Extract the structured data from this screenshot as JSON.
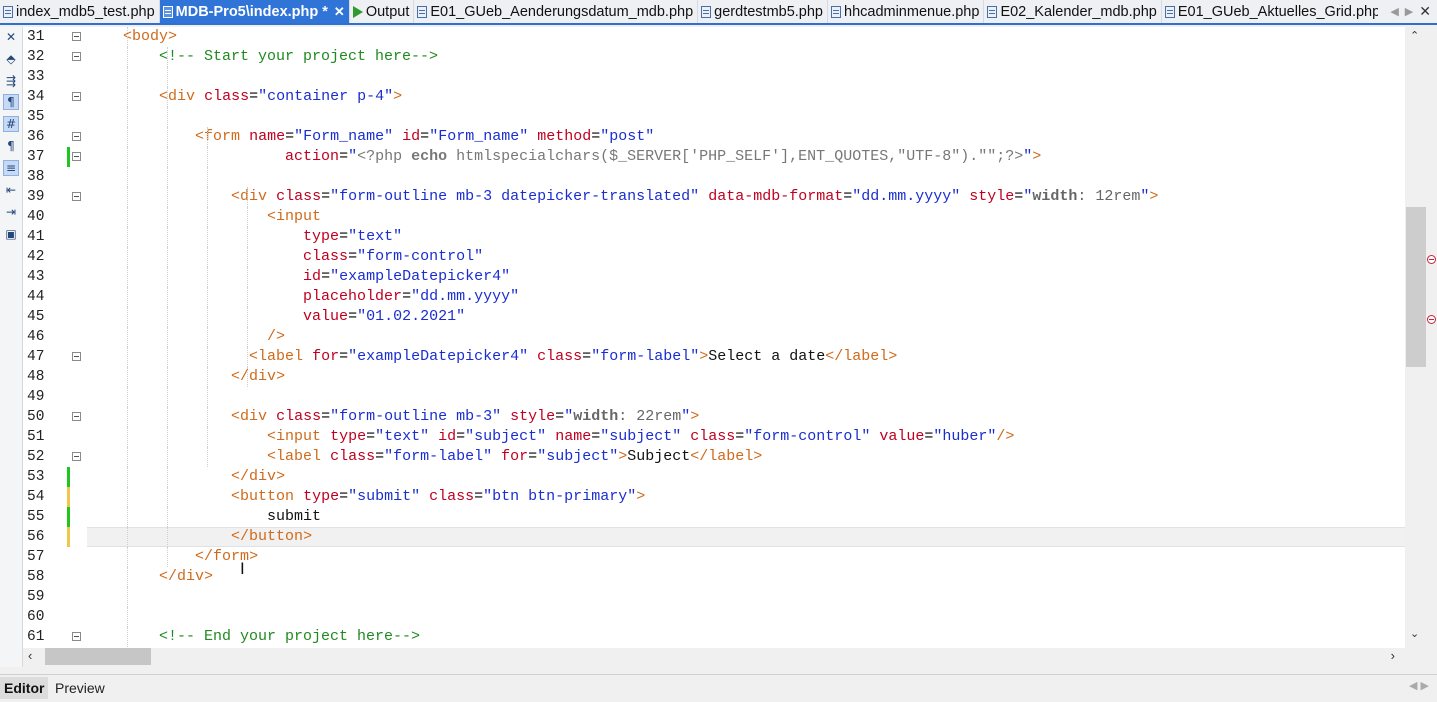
{
  "tabs": [
    {
      "label": "index_mdb5_test.php",
      "icon": "php-file-icon",
      "active": false
    },
    {
      "label": "MDB-Pro5\\index.php *",
      "icon": "php-file-icon",
      "active": true
    },
    {
      "label": "Output",
      "icon": "play-icon",
      "active": false
    },
    {
      "label": "E01_GUeb_Aenderungsdatum_mdb.php",
      "icon": "php-file-icon",
      "active": false
    },
    {
      "label": "gerdtestmb5.php",
      "icon": "php-file-icon",
      "active": false
    },
    {
      "label": "hhcadminmenue.php",
      "icon": "php-file-icon",
      "active": false
    },
    {
      "label": "E02_Kalender_mdb.php",
      "icon": "php-file-icon",
      "active": false
    },
    {
      "label": "E01_GUeb_Aktuelles_Grid.php",
      "icon": "php-file-icon",
      "active": false
    }
  ],
  "tab_close_glyph": "✕",
  "left_toolbar": [
    "close-icon",
    "toggle-icon",
    "wrap-icon",
    "indent-guide-icon",
    "hash-icon",
    "pilcrow-icon",
    "format-icon",
    "outdent-icon",
    "indent-icon",
    "preview-icon"
  ],
  "code": {
    "lines": [
      {
        "n": "31",
        "fold": true,
        "chg": "",
        "html": "    <span class=\"t-brk\">&lt;</span><span class=\"t-tag\">body</span><span class=\"t-brk\">&gt;</span>"
      },
      {
        "n": "32",
        "fold": true,
        "chg": "",
        "html": "        <span class=\"t-cm\">&lt;!-- Start your project here--&gt;</span>"
      },
      {
        "n": "33",
        "fold": false,
        "chg": "",
        "html": ""
      },
      {
        "n": "34",
        "fold": true,
        "chg": "",
        "html": "        <span class=\"t-brk\">&lt;</span><span class=\"t-tag\">div</span> <span class=\"t-attr\">class</span>=<span class=\"t-val\">\"container p-4\"</span><span class=\"t-brk\">&gt;</span>"
      },
      {
        "n": "35",
        "fold": false,
        "chg": "",
        "html": ""
      },
      {
        "n": "36",
        "fold": true,
        "chg": "",
        "html": "            <span class=\"t-brk\">&lt;</span><span class=\"t-tag\">form</span> <span class=\"t-attr\">name</span>=<span class=\"t-val\">\"Form_name\"</span> <span class=\"t-attr\">id</span>=<span class=\"t-val\">\"Form_name\"</span> <span class=\"t-attr\">method</span>=<span class=\"t-val\">\"post\"</span>"
      },
      {
        "n": "37",
        "fold": true,
        "chg": "green",
        "html": "                      <span class=\"t-attr\">action</span>=<span class=\"t-val\">\"</span><span class=\"t-php\">&lt;?php </span><span class=\"t-phpk\">echo</span><span class=\"t-php\"> htmlspecialchars($_SERVER['PHP_SELF'],ENT_QUOTES,\"UTF-8\").\"\";?&gt;</span><span class=\"t-val\">\"</span><span class=\"t-brk\">&gt;</span>"
      },
      {
        "n": "38",
        "fold": false,
        "chg": "",
        "html": ""
      },
      {
        "n": "39",
        "fold": true,
        "chg": "",
        "html": "                <span class=\"t-brk\">&lt;</span><span class=\"t-tag\">div</span> <span class=\"t-attr\">class</span>=<span class=\"t-val\">\"form-outline mb-3 datepicker-translated\"</span> <span class=\"t-attr\">data-mdb-format</span>=<span class=\"t-val\">\"dd.mm.yyyy\"</span> <span class=\"t-attr\">style</span>=<span class=\"t-val\">\"</span><span class=\"t-cssk\">width</span><span class=\"t-cssv\">: 12rem</span><span class=\"t-val\">\"</span><span class=\"t-brk\">&gt;</span>"
      },
      {
        "n": "40",
        "fold": false,
        "chg": "",
        "html": "                    <span class=\"t-brk\">&lt;</span><span class=\"t-tag\">input</span>"
      },
      {
        "n": "41",
        "fold": false,
        "chg": "",
        "html": "                        <span class=\"t-attr\">type</span>=<span class=\"t-val\">\"text\"</span>"
      },
      {
        "n": "42",
        "fold": false,
        "chg": "",
        "html": "                        <span class=\"t-attr\">class</span>=<span class=\"t-val\">\"form-control\"</span>"
      },
      {
        "n": "43",
        "fold": false,
        "chg": "",
        "html": "                        <span class=\"t-attr\">id</span>=<span class=\"t-val\">\"exampleDatepicker4\"</span>"
      },
      {
        "n": "44",
        "fold": false,
        "chg": "",
        "html": "                        <span class=\"t-attr\">placeholder</span>=<span class=\"t-val\">\"dd.mm.yyyy\"</span>"
      },
      {
        "n": "45",
        "fold": false,
        "chg": "",
        "html": "                        <span class=\"t-attr\">value</span>=<span class=\"t-val\">\"01.02.2021\"</span>"
      },
      {
        "n": "46",
        "fold": false,
        "chg": "",
        "html": "                    <span class=\"t-brk\">/&gt;</span>"
      },
      {
        "n": "47",
        "fold": true,
        "chg": "",
        "html": "                  <span class=\"t-brk\">&lt;</span><span class=\"t-tag\">label</span> <span class=\"t-attr\">for</span>=<span class=\"t-val\">\"exampleDatepicker4\"</span> <span class=\"t-attr\">class</span>=<span class=\"t-val\">\"form-label\"</span><span class=\"t-brk\">&gt;</span><span class=\"t-txt\">Select a date</span><span class=\"t-brk\">&lt;/</span><span class=\"t-tag\">label</span><span class=\"t-brk\">&gt;</span>"
      },
      {
        "n": "48",
        "fold": false,
        "chg": "",
        "html": "                <span class=\"t-brk\">&lt;/</span><span class=\"t-tag\">div</span><span class=\"t-brk\">&gt;</span>"
      },
      {
        "n": "49",
        "fold": false,
        "chg": "",
        "html": ""
      },
      {
        "n": "50",
        "fold": true,
        "chg": "",
        "html": "                <span class=\"t-brk\">&lt;</span><span class=\"t-tag\">div</span> <span class=\"t-attr\">class</span>=<span class=\"t-val\">\"form-outline mb-3\"</span> <span class=\"t-attr\">style</span>=<span class=\"t-val\">\"</span><span class=\"t-cssk\">width</span><span class=\"t-cssv\">: 22rem</span><span class=\"t-val\">\"</span><span class=\"t-brk\">&gt;</span>"
      },
      {
        "n": "51",
        "fold": false,
        "chg": "",
        "html": "                    <span class=\"t-brk\">&lt;</span><span class=\"t-tag\">input</span> <span class=\"t-attr\">type</span>=<span class=\"t-val\">\"text\"</span> <span class=\"t-attr\">id</span>=<span class=\"t-val\">\"subject\"</span> <span class=\"t-attr\">name</span>=<span class=\"t-val\">\"subject\"</span> <span class=\"t-attr\">class</span>=<span class=\"t-val\">\"form-control\"</span> <span class=\"t-attr\">value</span>=<span class=\"t-val\">\"huber\"</span><span class=\"t-brk\">/&gt;</span>"
      },
      {
        "n": "52",
        "fold": true,
        "chg": "",
        "html": "                    <span class=\"t-brk\">&lt;</span><span class=\"t-tag\">label</span> <span class=\"t-attr\">class</span>=<span class=\"t-val\">\"form-label\"</span> <span class=\"t-attr\">for</span>=<span class=\"t-val\">\"subject\"</span><span class=\"t-brk\">&gt;</span><span class=\"t-txt\">Subject</span><span class=\"t-brk\">&lt;/</span><span class=\"t-tag\">label</span><span class=\"t-brk\">&gt;</span>"
      },
      {
        "n": "53",
        "fold": false,
        "chg": "green",
        "html": "                <span class=\"t-brk\">&lt;/</span><span class=\"t-tag\">div</span><span class=\"t-brk\">&gt;</span>"
      },
      {
        "n": "54",
        "fold": false,
        "chg": "yellow",
        "html": "                <span class=\"t-brk\">&lt;</span><span class=\"t-tag\">button</span> <span class=\"t-attr\">type</span>=<span class=\"t-val\">\"submit\"</span> <span class=\"t-attr\">class</span>=<span class=\"t-val\">\"btn btn-primary\"</span><span class=\"t-brk\">&gt;</span>"
      },
      {
        "n": "55",
        "fold": false,
        "chg": "green",
        "html": "                   <span class=\"t-txt\"> submit</span>"
      },
      {
        "n": "56",
        "fold": false,
        "chg": "yellow",
        "cur": true,
        "html": "                <span class=\"t-brk\">&lt;/</span><span class=\"t-tag\">button</span><span class=\"t-brk\">&gt;</span>"
      },
      {
        "n": "57",
        "fold": false,
        "chg": "",
        "html": "            <span class=\"t-brk\">&lt;/</span><span class=\"t-tag\">form</span><span class=\"t-brk\">&gt;</span>"
      },
      {
        "n": "58",
        "fold": false,
        "chg": "",
        "html": "        <span class=\"t-brk\">&lt;/</span><span class=\"t-tag\">div</span><span class=\"t-brk\">&gt;</span>"
      },
      {
        "n": "59",
        "fold": false,
        "chg": "",
        "html": ""
      },
      {
        "n": "60",
        "fold": false,
        "chg": "",
        "html": ""
      },
      {
        "n": "61",
        "fold": true,
        "chg": "",
        "html": "        <span class=\"t-cm\">&lt;!-- End your project here--&gt;</span>"
      }
    ]
  },
  "bottom_tabs": [
    {
      "label": "Editor",
      "active": true
    },
    {
      "label": "Preview",
      "active": false
    }
  ],
  "colors": {
    "accent": "#2f74d6",
    "change_green": "#22c422",
    "change_yellow": "#f0c64a"
  }
}
